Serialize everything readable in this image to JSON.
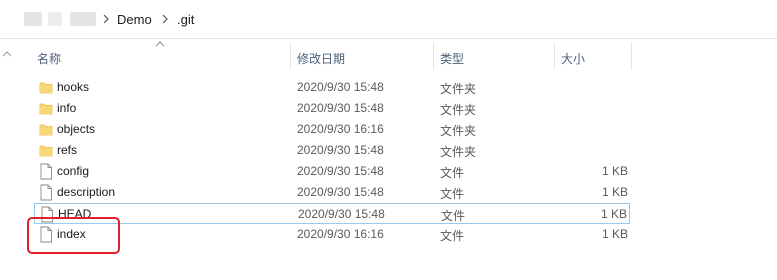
{
  "breadcrumb": {
    "parts": [
      "Demo",
      ".git"
    ]
  },
  "columns": {
    "name": "名称",
    "date": "修改日期",
    "type": "类型",
    "size": "大小"
  },
  "rows": [
    {
      "name": "hooks",
      "date": "2020/9/30 15:48",
      "type": "文件夹",
      "size": "",
      "icon": "folder-icon"
    },
    {
      "name": "info",
      "date": "2020/9/30 15:48",
      "type": "文件夹",
      "size": "",
      "icon": "folder-icon"
    },
    {
      "name": "objects",
      "date": "2020/9/30 16:16",
      "type": "文件夹",
      "size": "",
      "icon": "folder-icon"
    },
    {
      "name": "refs",
      "date": "2020/9/30 15:48",
      "type": "文件夹",
      "size": "",
      "icon": "folder-icon"
    },
    {
      "name": "config",
      "date": "2020/9/30 15:48",
      "type": "文件",
      "size": "1 KB",
      "icon": "file-icon"
    },
    {
      "name": "description",
      "date": "2020/9/30 15:48",
      "type": "文件",
      "size": "1 KB",
      "icon": "file-icon"
    },
    {
      "name": "HEAD",
      "date": "2020/9/30 15:48",
      "type": "文件",
      "size": "1 KB",
      "icon": "file-icon"
    },
    {
      "name": "index",
      "date": "2020/9/30 16:16",
      "type": "文件",
      "size": "1 KB",
      "icon": "file-icon"
    }
  ],
  "colors": {
    "folder": "#f8d775",
    "folder_dark": "#e6b948",
    "header_text": "#4c607a",
    "highlight": "#e0202a",
    "focus_border": "#99c9ef"
  }
}
